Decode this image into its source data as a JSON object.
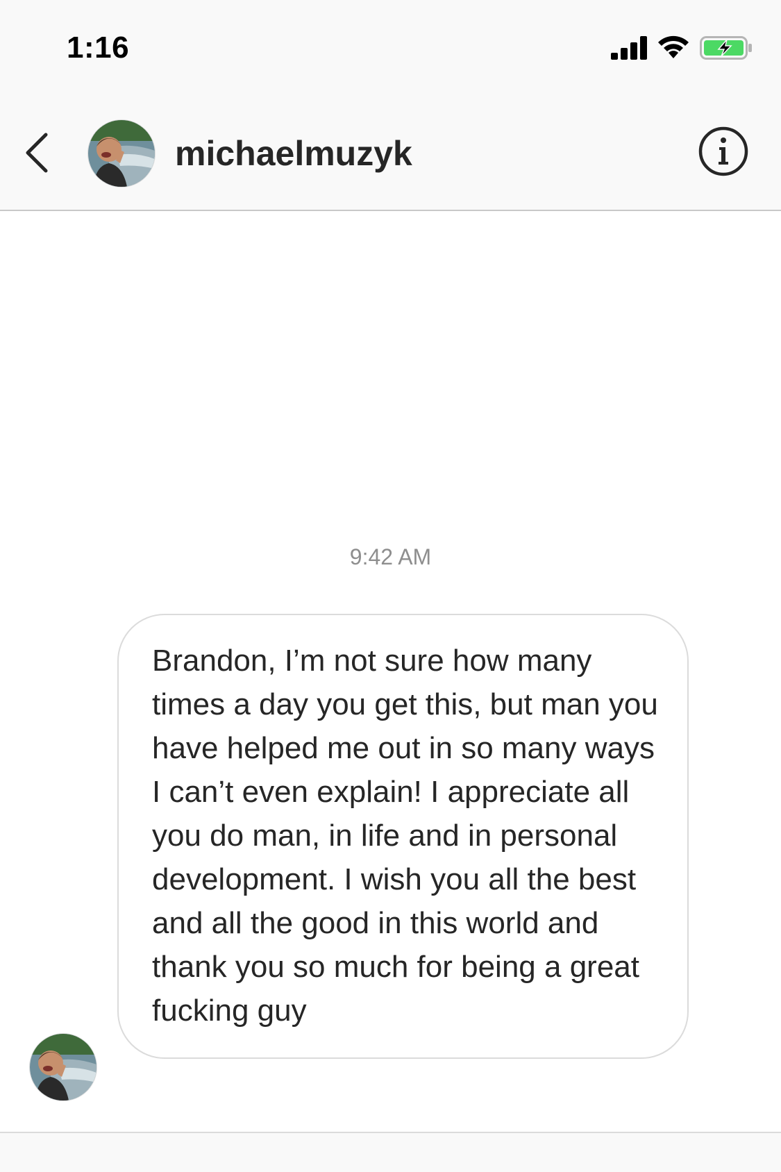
{
  "status_bar": {
    "time": "1:16",
    "icons": [
      "signal-icon",
      "wifi-icon",
      "battery-charging-icon"
    ],
    "battery_color": "#4cd964"
  },
  "header": {
    "username": "michaelmuzyk",
    "back_icon": "chevron-left-icon",
    "info_icon": "info-circle-icon"
  },
  "conversation": {
    "timestamp": "9:42 AM",
    "messages": [
      {
        "sender": "michaelmuzyk",
        "text": "Brandon, I’m not sure how many times a day you get this, but man you have helped me out in so many ways I can’t even explain! I appreciate all you do man, in life and in personal development. I wish you all the best and all the good in this world and thank you so much for being a great fucking guy"
      }
    ]
  },
  "colors": {
    "bar_background": "#f9f9f9",
    "text_primary": "#262626",
    "text_secondary": "#8e8e8e",
    "bubble_border": "#dbdbdb"
  }
}
